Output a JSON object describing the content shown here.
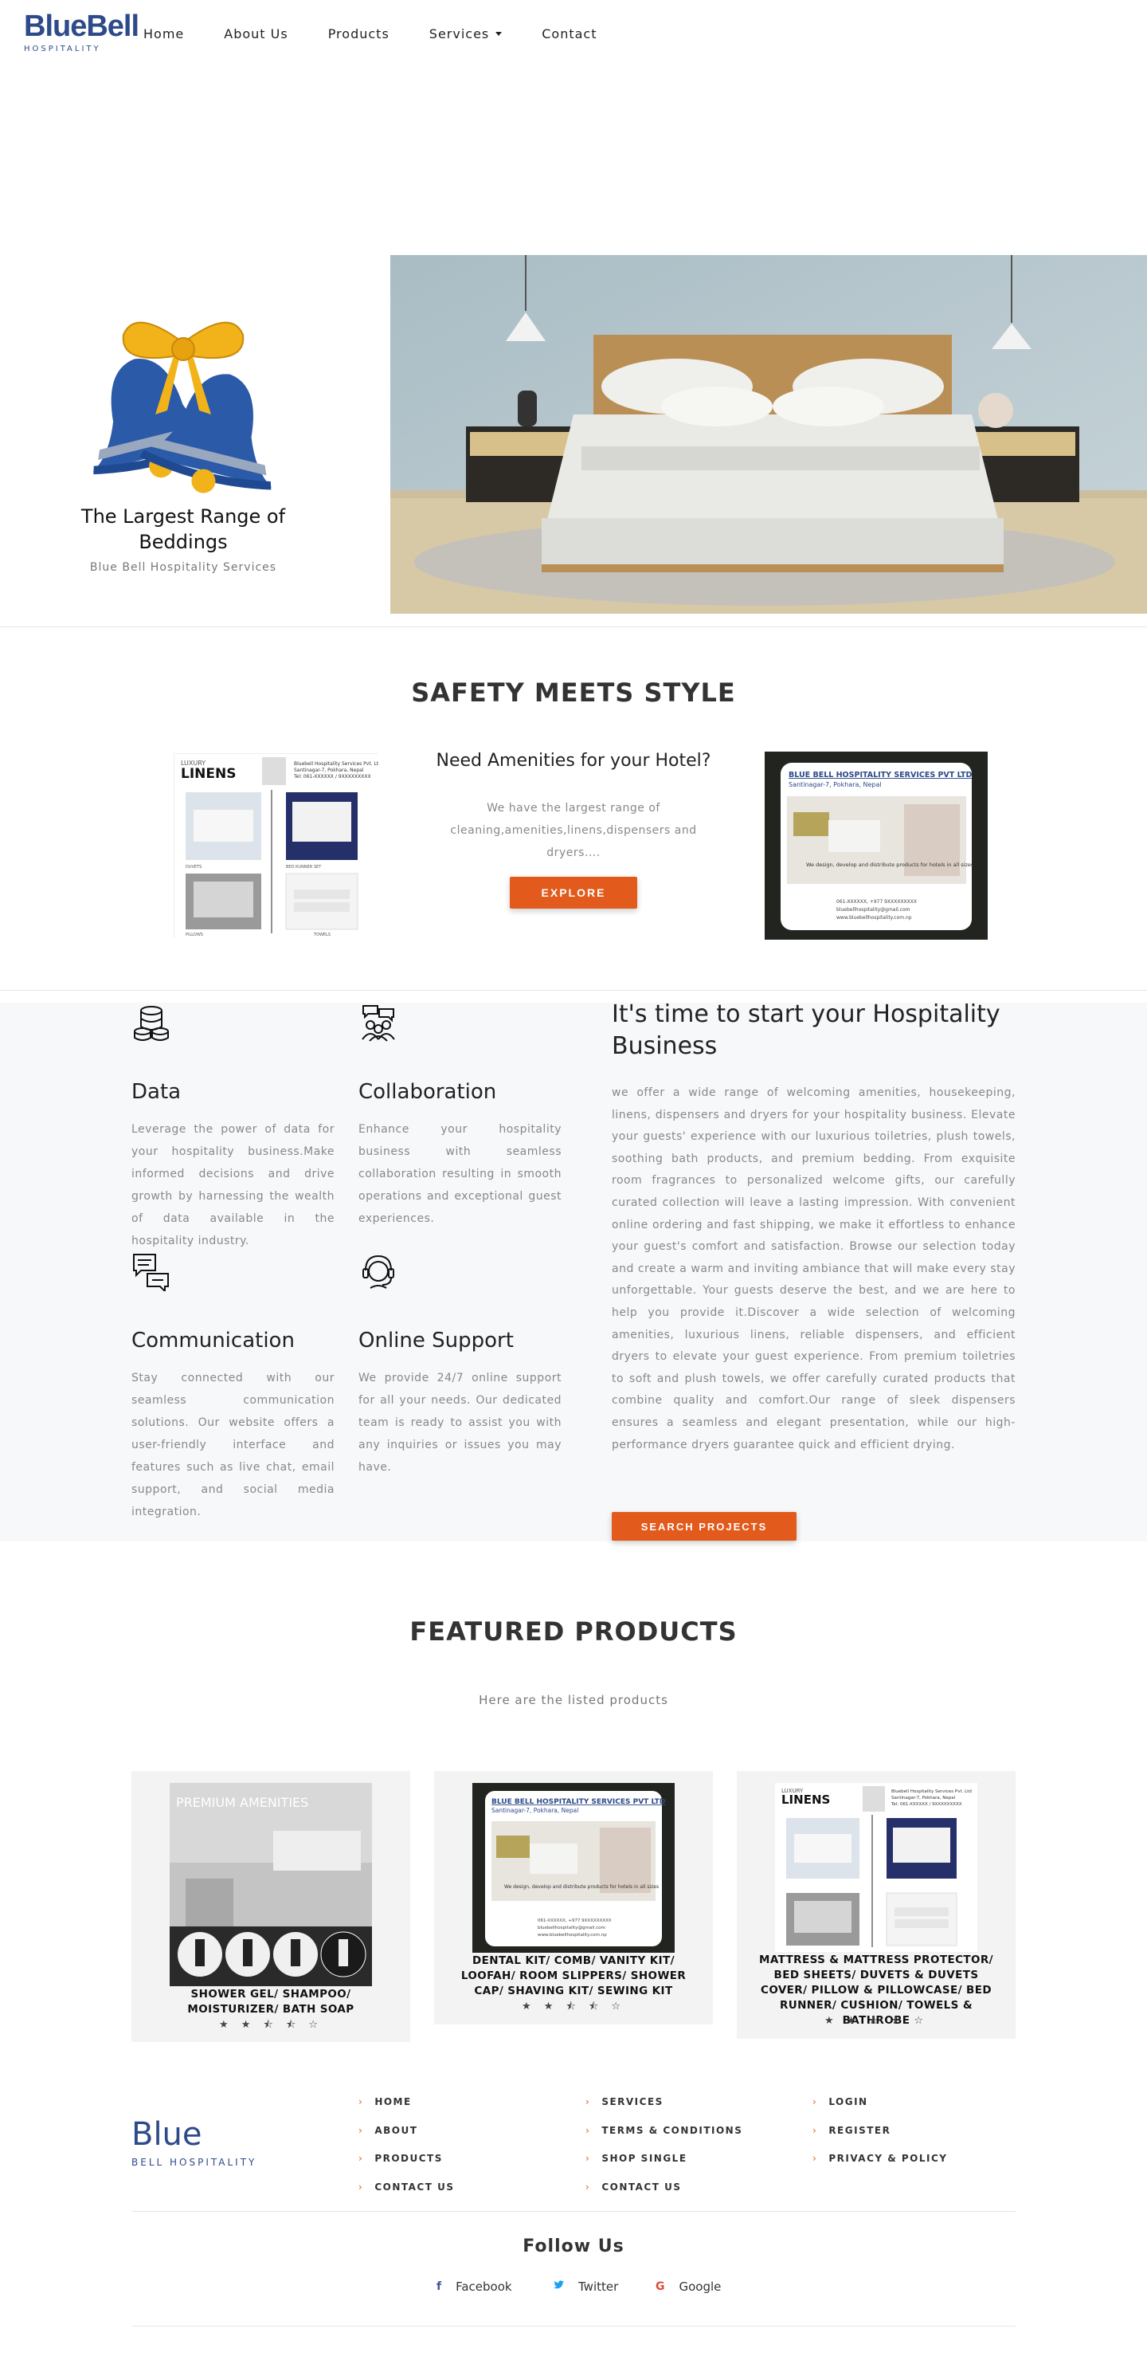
{
  "nav": {
    "logo_blue": "Blue",
    "logo_bell": "Bell",
    "logo_sub": "HOSPITALITY",
    "items": [
      {
        "label": "Home"
      },
      {
        "label": "About Us"
      },
      {
        "label": "Products"
      },
      {
        "label": "Services"
      },
      {
        "label": "Contact"
      }
    ]
  },
  "hero": {
    "title": "The Largest Range of Beddings",
    "subtitle": "Blue Bell Hospitality Services"
  },
  "safety": {
    "title": "SAFETY MEETS STYLE",
    "amenities_title": "Need Amenities for your Hotel?",
    "amenities_desc": "We have the largest range of cleaning,amenities,linens,dispensers and dryers....",
    "explore_label": "EXPLORE"
  },
  "linens_poster": {
    "luxury": "LUXURY",
    "linens": "LINENS",
    "company": "Bluebell Hospitality Services Pvt. Ltd",
    "address": "Santinagar-7, Pokhara, Nepal",
    "tel": "Tel: 061-XXXXXX / 9XXXXXXXXX",
    "labels": [
      "DUVETS",
      "BED RUNNER SET",
      "PILLOWS",
      "TOWELS"
    ]
  },
  "blue_poster": {
    "company": "BLUE BELL HOSPITALITY SERVICES PVT LTD",
    "address": "Santinagar-7, Pokhara, Nepal",
    "tagline": "We design, develop and distribute products for hotels in all sizes",
    "contacts": [
      "061-XXXXXX, +977 9XXXXXXXXX",
      "bluebellhospitality@gmail.com",
      "www.bluebellhospitality.com.np"
    ]
  },
  "features": {
    "items": [
      {
        "title": "Data",
        "icon": "database-icon",
        "desc": "Leverage the power of data for your hospitality business.Make informed decisions and drive growth by harnessing the wealth of data available in the hospitality industry."
      },
      {
        "title": "Collaboration",
        "icon": "collaboration-icon",
        "desc": "Enhance your hospitality business with seamless collaboration resulting in smooth operations and exceptional guest experiences."
      },
      {
        "title": "Communication",
        "icon": "chat-icon",
        "desc": "Stay connected with our seamless communication solutions. Our website offers a user-friendly interface and features such as live chat, email support, and social media integration."
      },
      {
        "title": "Online Support",
        "icon": "headset-icon",
        "desc": "We provide 24/7 online support for all your needs. Our dedicated team is ready to assist you with any inquiries or issues you may have."
      }
    ],
    "big_title": "It's time to start your Hospitality Business",
    "big_text": "we offer a wide range of welcoming amenities, housekeeping, linens, dispensers and dryers for your hospitality business. Elevate your guests' experience with our luxurious toiletries, plush towels, soothing bath products, and premium bedding. From exquisite room fragrances to personalized welcome gifts, our carefully curated collection will leave a lasting impression. With convenient online ordering and fast shipping, we make it effortless to enhance your guest's comfort and satisfaction. Browse our selection today and create a warm and inviting ambiance that will make every stay unforgettable. Your guests deserve the best, and we are here to help you provide it.Discover a wide selection of welcoming amenities, luxurious linens, reliable dispensers, and efficient dryers to elevate your guest experience. From premium toiletries to soft and plush towels, we offer carefully curated products that combine quality and comfort.Our range of sleek dispensers ensures a seamless and elegant presentation, while our high-performance dryers guarantee quick and efficient drying.",
    "button": "SEARCH PROJECTS"
  },
  "products": {
    "title": "FEATURED PRODUCTS",
    "subtitle": "Here are the listed products",
    "items": [
      {
        "name": "SHOWER GEL/ SHAMPOO/ MOISTURIZER/ BATH SOAP",
        "rating": 3.5,
        "stars": "★ ★ ⯪ ⯪ ☆",
        "poster_title": "PREMIUM AMENITIES"
      },
      {
        "name": "DENTAL KIT/ COMB/ VANITY KIT/ LOOFAH/ ROOM SLIPPERS/ SHOWER CAP/ SHAVING KIT/ SEWING KIT",
        "rating": 3.5,
        "stars": "★ ★ ⯪ ⯪ ☆"
      },
      {
        "name": "MATTRESS & MATTRESS PROTECTOR/ BED SHEETS/ DUVETS & DUVETS COVER/ PILLOW & PILLOWCASE/ BED RUNNER/ CUSHION/ TOWELS & BATHROBE",
        "rating": 3.5,
        "stars": "★ ★ ⯪ ⯪ ☆"
      }
    ]
  },
  "footer": {
    "brand": "Blue",
    "brand_sub": "BELL HOSPITALITY",
    "col1": [
      "HOME",
      "ABOUT",
      "PRODUCTS",
      "CONTACT US"
    ],
    "col2": [
      "SERVICES",
      "TERMS & CONDITIONS",
      "SHOP SINGLE",
      "CONTACT US"
    ],
    "col3": [
      "LOGIN",
      "REGISTER",
      "PRIVACY & POLICY"
    ],
    "follow": "Follow Us",
    "social": [
      {
        "label": "Facebook",
        "icon": "facebook-icon",
        "glyph": "f",
        "color": "#3b5998"
      },
      {
        "label": "Twitter",
        "icon": "twitter-icon",
        "glyph": "🐦",
        "color": "#1da1f2"
      },
      {
        "label": "Google",
        "icon": "google-icon",
        "glyph": "G",
        "color": "#dd4b39"
      }
    ]
  },
  "colors": {
    "accent": "#e25a1c",
    "brand": "#2d4a8a",
    "bell_blue": "#2a5aa8",
    "bell_gold": "#f2b21a"
  }
}
